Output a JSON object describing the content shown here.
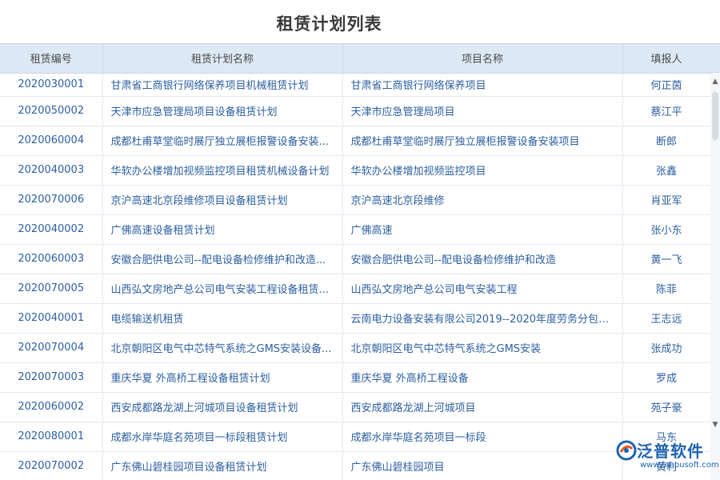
{
  "page": {
    "title": "租赁计划列表"
  },
  "table": {
    "headers": [
      "租赁编号",
      "租赁计划名称",
      "项目名称",
      "填报人"
    ],
    "rows": [
      [
        "2020030001",
        "甘肃省工商银行网络保养项目机械租赁计划",
        "甘肃省工商银行网络保养项目",
        "何正茵"
      ],
      [
        "2020050002",
        "天津市应急管理局项目设备租赁计划",
        "天津市应急管理局项目",
        "蔡江平"
      ],
      [
        "2020060004",
        "成都杜甫草堂临时展厅独立展柜报警设备安装...",
        "成都杜甫草堂临时展厅独立展柜报警设备安装项目",
        "断郎"
      ],
      [
        "2020040003",
        "华软办公楼增加视频监控项目租赁机械设备计划",
        "华软办公楼增加视频监控项目",
        "张鑫"
      ],
      [
        "2020070006",
        "京沪高速北京段维修项目设备租赁计划",
        "京沪高速北京段维修",
        "肖亚军"
      ],
      [
        "2020040002",
        "广佛高速设备租赁计划",
        "广佛高速",
        "张小东"
      ],
      [
        "2020060003",
        "安徽合肥供电公司--配电设备检修维护和改造...",
        "安徽合肥供电公司--配电设备检修维护和改造",
        "黄一飞"
      ],
      [
        "2020070005",
        "山西弘文房地产总公司电气安装工程设备租赁...",
        "山西弘文房地产总公司电气安装工程",
        "陈菲"
      ],
      [
        "2020040001",
        "电缆输送机租赁",
        "云南电力设备安装有限公司2019--2020年度劳务分包合...",
        "王志远"
      ],
      [
        "2020070004",
        "北京朝阳区电气中芯特气系统之GMS安装设备...",
        "北京朝阳区电气中芯特气系统之GMS安装",
        "张成功"
      ],
      [
        "2020070003",
        "重庆华夏 外高桥工程设备租赁计划",
        "重庆华夏 外高桥工程设备",
        "罗成"
      ],
      [
        "2020060002",
        "西安成都路龙湖上河城项目设备租赁计划",
        "西安成都路龙湖上河城项目",
        "苑子豪"
      ],
      [
        "2020080001",
        "成都水岸华庭名苑项目一标段租赁计划",
        "成都水岸华庭名苑项目一标段",
        "马东"
      ],
      [
        "2020070002",
        "广东佛山碧桂园项目设备租赁计划",
        "广东佛山碧桂园项目",
        "黄利"
      ]
    ]
  },
  "scroll": {
    "up_glyph": "▲",
    "down_glyph": "▼"
  },
  "logo": {
    "name": "泛普软件",
    "url": "www.fanpusoft.com",
    "icon": "fanpu-logo-icon",
    "color": "#1f63b0"
  }
}
